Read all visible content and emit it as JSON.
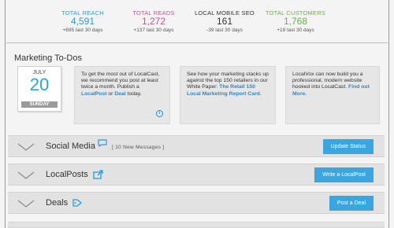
{
  "stats": [
    {
      "label": "TOTAL REACH",
      "value": "4,591",
      "sub": "+695 last 30 days",
      "color": "#2a9bd6"
    },
    {
      "label": "TOTAL READS",
      "value": "1,272",
      "sub": "+137 last 30 days",
      "color": "#c94ea2"
    },
    {
      "label": "LOCAL MOBILE SEO",
      "value": "161",
      "sub": "-39 last 30 days",
      "color": "#333333"
    },
    {
      "label": "TOTAL CUSTOMERS",
      "value": "1,768",
      "sub": "+19 last 30 days",
      "color": "#6ab04c"
    }
  ],
  "todos": {
    "title": "Marketing To-Dos",
    "calendar": {
      "month": "JULY",
      "day": "20",
      "weekday": "SUNDAY"
    },
    "cards": [
      {
        "text1": "To get the most out of LocalCast, we recommend you post at least twice a month. Publish a ",
        "link1": "LocalPost",
        "text2": " or ",
        "link2": "Deal",
        "text3": " today."
      },
      {
        "text1": "See how your marketing stacks up against the top 150 retailers in our White Paper: ",
        "link1": "The Retail 150 Local Marketing Report Card",
        "text2": "."
      },
      {
        "text1": "LocalVox can now build you a professional, modern website hooked into LocalCast. ",
        "link1": "Find out More."
      }
    ]
  },
  "sections": [
    {
      "title": "Social Media",
      "extra": "[ 10 New Messages ]",
      "icon": "speech-bubble-icon",
      "button": "Update Status"
    },
    {
      "title": "LocalPosts",
      "extra": "",
      "icon": "share-icon",
      "button": "Write a LocalPost"
    },
    {
      "title": "Deals",
      "extra": "",
      "icon": "tag-icon",
      "button": "Post a Deal"
    }
  ]
}
